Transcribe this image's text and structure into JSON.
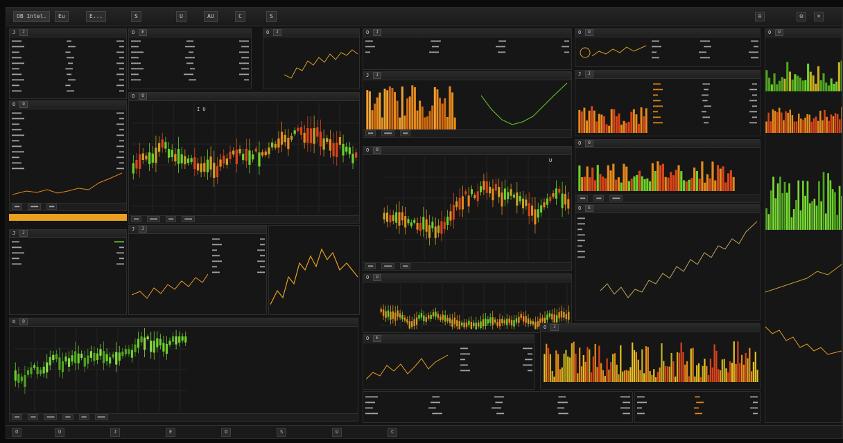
{
  "topbar": {
    "title": "OB Intel.",
    "tabs": [
      "Eu",
      "E...",
      "S",
      "U",
      "AU",
      "C",
      "S"
    ],
    "icons": [
      "menu-icon",
      "settings-icon",
      "close-icon"
    ]
  },
  "panels": {
    "left_top": {
      "title": "J",
      "btn": "J"
    },
    "left_mid": {
      "title": "O",
      "btn": "O"
    },
    "left_lower": {
      "title": "J",
      "btn": "J"
    },
    "main_chart": {
      "title": "O",
      "btn": "O",
      "label": "I U"
    },
    "mid_top": {
      "title": "O",
      "btn": "J"
    },
    "mid_small": {
      "title": "O",
      "btn": "E"
    },
    "bars_panel": {
      "title": "J",
      "btn": "J"
    },
    "candle_mid": {
      "title": "O",
      "btn": "O",
      "label": "U"
    },
    "candle_wide": {
      "title": "O",
      "btn": "U"
    },
    "right_top": {
      "title": "O",
      "btn": "O"
    },
    "right_table": {
      "title": "J",
      "btn": "J"
    },
    "right_bars": {
      "title": "O",
      "btn": "O"
    },
    "right_line": {
      "title": "O",
      "btn": "E"
    },
    "right_volume": {
      "title": "O",
      "btn": "J"
    },
    "bottom_left": {
      "title": "O",
      "btn": "O"
    },
    "edge": {
      "title": "O",
      "btn": "U"
    }
  },
  "highlight_bar": {
    "label": "IT"
  },
  "bottombar": {
    "tabs": [
      "O",
      "U",
      "J",
      "E",
      "O",
      "S",
      "U",
      "C"
    ]
  },
  "colors": {
    "green": "#6bd12a",
    "orange": "#e88a1a",
    "red": "#d9441a",
    "bg": "#161616"
  }
}
